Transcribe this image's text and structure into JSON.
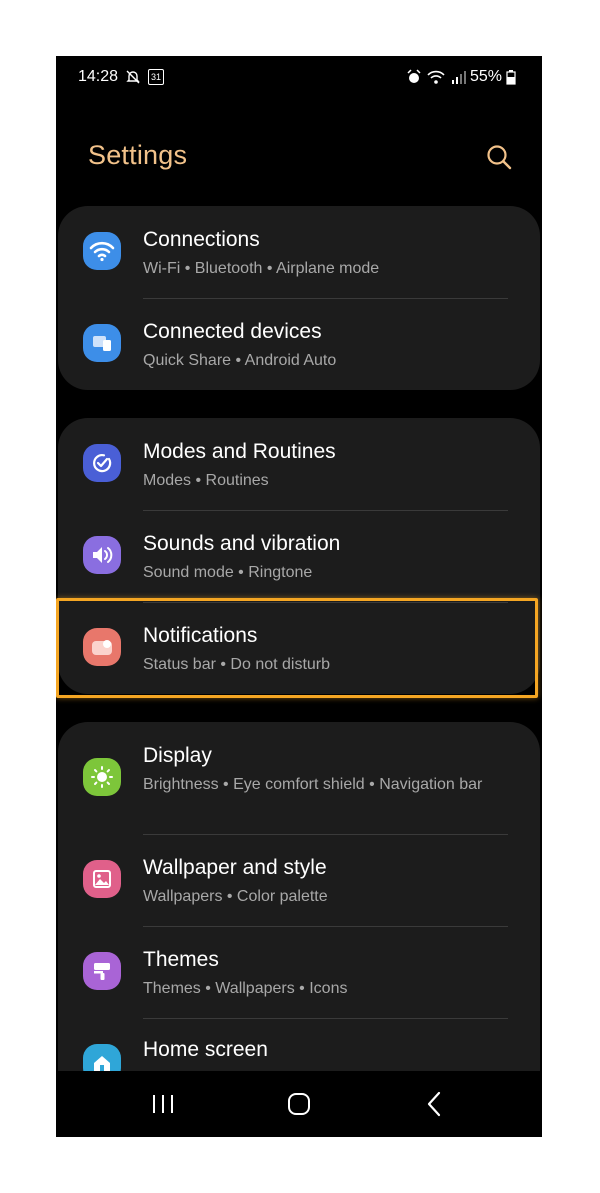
{
  "status_bar": {
    "time": "14:28",
    "calendar_day": "31",
    "battery": "55%"
  },
  "header": {
    "title": "Settings"
  },
  "groups": [
    {
      "items": [
        {
          "title": "Connections",
          "subtitle": "Wi-Fi  •  Bluetooth  •  Airplane mode",
          "icon": "wifi-icon",
          "color": "#3d8ee8"
        },
        {
          "title": "Connected devices",
          "subtitle": "Quick Share  •  Android Auto",
          "icon": "devices-icon",
          "color": "#3d8ee8"
        }
      ]
    },
    {
      "items": [
        {
          "title": "Modes and Routines",
          "subtitle": "Modes  •  Routines",
          "icon": "check-circle-icon",
          "color": "#4a5fd6"
        },
        {
          "title": "Sounds and vibration",
          "subtitle": "Sound mode  •  Ringtone",
          "icon": "speaker-icon",
          "color": "#8a6ee0"
        },
        {
          "title": "Notifications",
          "subtitle": "Status bar  •  Do not disturb",
          "icon": "notification-icon",
          "color": "#e8776b"
        }
      ]
    },
    {
      "items": [
        {
          "title": "Display",
          "subtitle": "Brightness  •  Eye comfort shield  •  Navigation bar",
          "icon": "sun-icon",
          "color": "#7dc63a"
        },
        {
          "title": "Wallpaper and style",
          "subtitle": "Wallpapers  •  Color palette",
          "icon": "image-icon",
          "color": "#e0608a"
        },
        {
          "title": "Themes",
          "subtitle": "Themes  •  Wallpapers  •  Icons",
          "icon": "brush-icon",
          "color": "#a964d6"
        },
        {
          "title": "Home screen",
          "subtitle": "",
          "icon": "home-icon",
          "color": "#2fa6d8"
        }
      ]
    }
  ],
  "accent_color": "#f2c28a",
  "highlight_color": "#f5a623"
}
